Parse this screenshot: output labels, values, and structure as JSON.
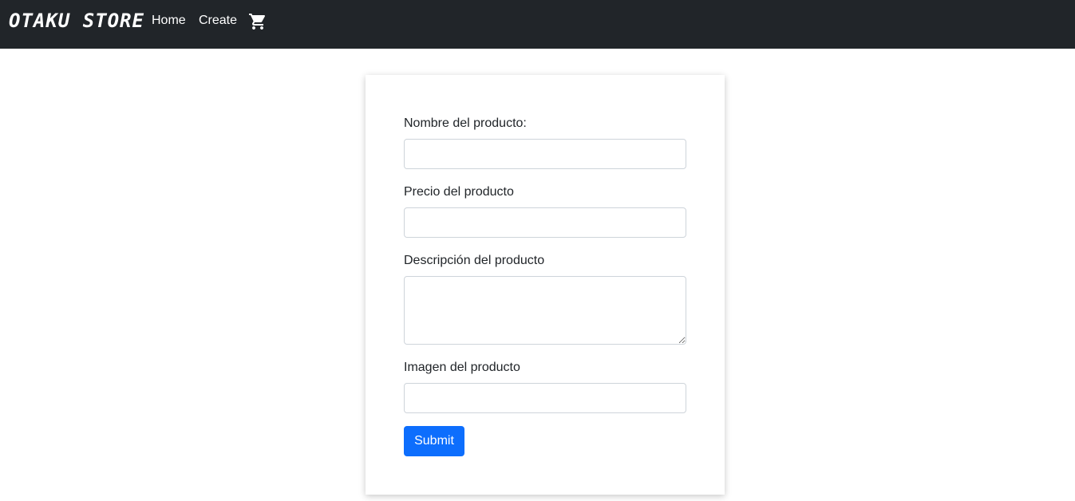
{
  "navbar": {
    "brand": "OTAKU STORE",
    "links": [
      {
        "label": "Home"
      },
      {
        "label": "Create"
      }
    ],
    "cart_icon": "shopping-cart-icon"
  },
  "form": {
    "name_label": "Nombre del producto:",
    "name_value": "",
    "price_label": "Precio del producto",
    "price_value": "",
    "description_label": "Descripción del producto",
    "description_value": "",
    "image_label": "Imagen del producto",
    "image_value": "",
    "submit_label": "Submit"
  },
  "colors": {
    "navbar_bg": "#212529",
    "primary_button": "#0d6efd",
    "input_border": "#ced4da"
  }
}
